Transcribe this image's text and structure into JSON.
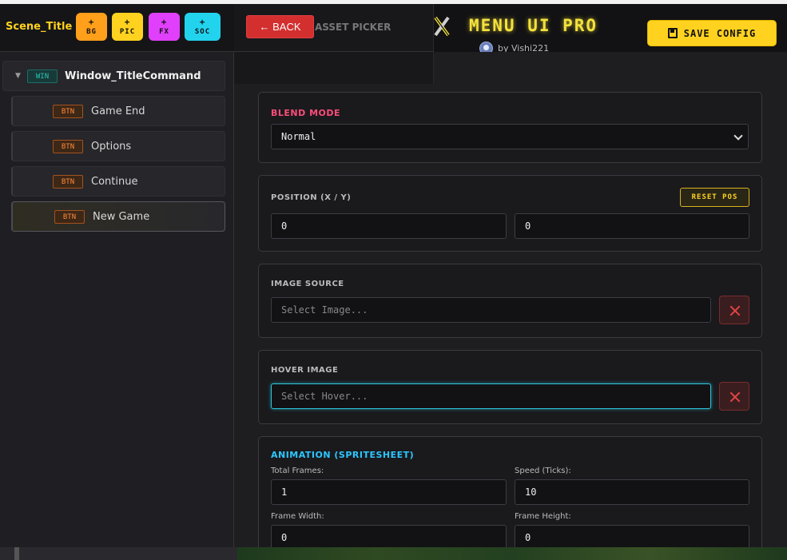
{
  "sidebar": {
    "scene_title": "Scene_Title",
    "add_buttons": [
      {
        "plus": "+",
        "label": "BG",
        "color": "#ff9f1a"
      },
      {
        "plus": "+",
        "label": "PIC",
        "color": "#ffd21f"
      },
      {
        "plus": "+",
        "label": "FX",
        "color": "#e040fb"
      },
      {
        "plus": "+",
        "label": "SOC",
        "color": "#22d3ee"
      }
    ],
    "tree": {
      "arrow": "▼",
      "window": {
        "tag": "WIN",
        "label": "Window_TitleCommand"
      },
      "buttons": [
        {
          "tag": "BTN",
          "label": "Game End"
        },
        {
          "tag": "BTN",
          "label": "Options"
        },
        {
          "tag": "BTN",
          "label": "Continue"
        },
        {
          "tag": "BTN",
          "label": "New Game"
        }
      ]
    }
  },
  "overlay": {
    "back_label": "← BACK",
    "title": "ASSET PICKER"
  },
  "header": {
    "brand": "MENU UI PRO",
    "byline": "by Vishi221",
    "save_label": "SAVE CONFIG"
  },
  "form": {
    "blend_mode": {
      "label": "BLEND MODE",
      "value": "Normal",
      "label_color": "#ff4d7a"
    },
    "position": {
      "label": "POSITION (X / Y)",
      "reset_label": "RESET POS",
      "x": "0",
      "y": "0"
    },
    "image_source": {
      "label": "IMAGE SOURCE",
      "placeholder": "Select Image..."
    },
    "hover_image": {
      "label": "HOVER IMAGE",
      "placeholder": "Select Hover..."
    },
    "animation": {
      "label": "ANIMATION (SPRITESHEET)",
      "label_color": "#2cc7ff",
      "total_frames_label": "Total Frames:",
      "total_frames": "1",
      "speed_label": "Speed (Ticks):",
      "speed": "10",
      "frame_width_label": "Frame Width:",
      "frame_width": "0",
      "frame_height_label": "Frame Height:",
      "frame_height": "0"
    }
  }
}
